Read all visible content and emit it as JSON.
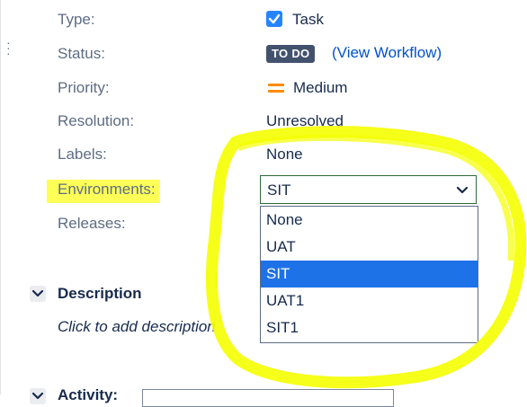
{
  "fields": {
    "type": {
      "label": "Type:",
      "value": "Task",
      "icon": "checkbox-icon"
    },
    "status": {
      "label": "Status:",
      "lozenge": "TO DO",
      "link": "(View Workflow)"
    },
    "priority": {
      "label": "Priority:",
      "value": "Medium",
      "icon": "priority-medium-icon"
    },
    "resolution": {
      "label": "Resolution:",
      "value": "Unresolved"
    },
    "labels": {
      "label": "Labels:",
      "value": "None"
    },
    "environments": {
      "label": "Environments:",
      "selected": "SIT"
    },
    "releases": {
      "label": "Releases:"
    }
  },
  "dropdown": {
    "options": [
      "None",
      "UAT",
      "SIT",
      "UAT1",
      "SIT1"
    ],
    "selected_index": 2
  },
  "description": {
    "title": "Description",
    "placeholder": "Click to add description"
  },
  "activity": {
    "title": "Activity:"
  },
  "colors": {
    "accent_blue": "#2684ff",
    "link_blue": "#0052cc",
    "lozenge_bg": "#42526e",
    "priority_orange": "#ff8b00",
    "highlight_yellow": "#fdff3a",
    "selected_option_bg": "#1e72e8"
  }
}
